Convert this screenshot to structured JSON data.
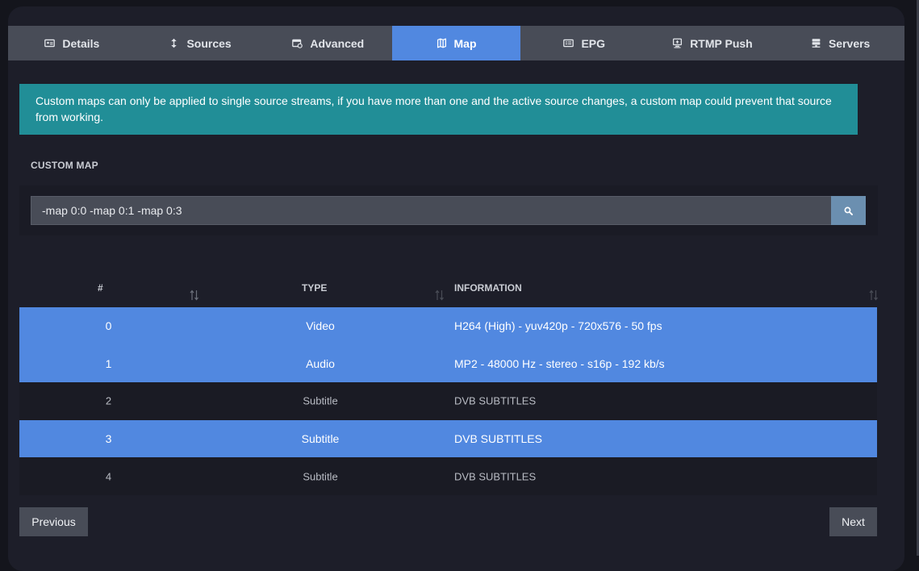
{
  "tabs": [
    {
      "label": "Details",
      "icon": "id-card-icon"
    },
    {
      "label": "Sources",
      "icon": "arrows-icon"
    },
    {
      "label": "Advanced",
      "icon": "calendar-gear-icon"
    },
    {
      "label": "Map",
      "icon": "map-icon"
    },
    {
      "label": "EPG",
      "icon": "tv-guide-icon"
    },
    {
      "label": "RTMP Push",
      "icon": "monitor-upload-icon"
    },
    {
      "label": "Servers",
      "icon": "server-icon"
    }
  ],
  "active_tab": "Map",
  "alert": {
    "text": "Custom maps can only be applied to single source streams, if you have more than one and the active source changes, a custom map could prevent that source from working."
  },
  "custom_map": {
    "label": "CUSTOM MAP",
    "value": "-map 0:0 -map 0:1 -map 0:3"
  },
  "table": {
    "headers": {
      "num": "#",
      "type": "TYPE",
      "info": "INFORMATION"
    },
    "rows": [
      {
        "num": "0",
        "type": "Video",
        "info": "H264 (High) - yuv420p - 720x576 - 50 fps",
        "selected": true
      },
      {
        "num": "1",
        "type": "Audio",
        "info": "MP2 - 48000 Hz - stereo - s16p - 192 kb/s",
        "selected": true
      },
      {
        "num": "2",
        "type": "Subtitle",
        "info": "DVB SUBTITLES",
        "selected": false
      },
      {
        "num": "3",
        "type": "Subtitle",
        "info": "DVB SUBTITLES",
        "selected": true
      },
      {
        "num": "4",
        "type": "Subtitle",
        "info": "DVB SUBTITLES",
        "selected": false
      }
    ]
  },
  "pager": {
    "previous": "Previous",
    "next": "Next"
  },
  "colors": {
    "accent": "#5188e0",
    "alert": "#218e97",
    "tab_bar": "#484c57"
  }
}
